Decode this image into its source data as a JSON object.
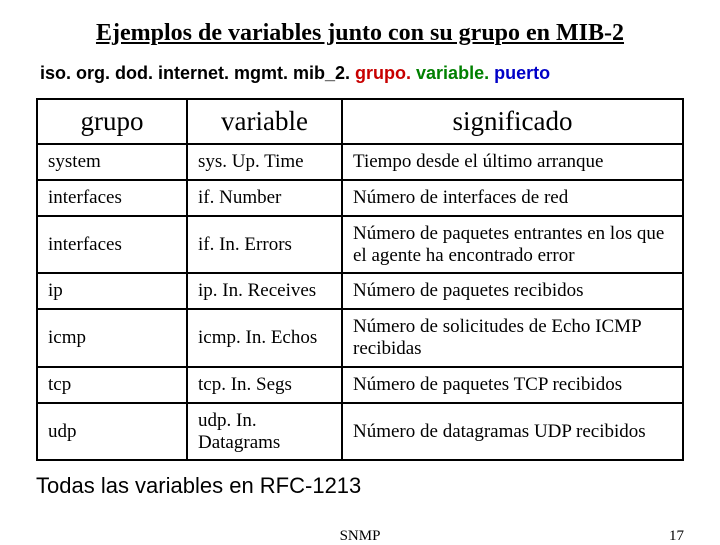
{
  "title": "Ejemplos de variables junto con su grupo en MIB-2",
  "oid": {
    "prefix": "iso. org. dod. internet. mgmt. mib_2.",
    "grupo": " grupo.",
    "variable": " variable.",
    "puerto": " puerto"
  },
  "headers": {
    "grupo": "grupo",
    "variable": "variable",
    "significado": "significado"
  },
  "rows": [
    {
      "grupo": "system",
      "variable": "sys. Up. Time",
      "significado": "Tiempo desde el último arranque"
    },
    {
      "grupo": "interfaces",
      "variable": "if. Number",
      "significado": "Número de interfaces de red"
    },
    {
      "grupo": "interfaces",
      "variable": "if. In. Errors",
      "significado": "Número de paquetes entrantes en los que el agente ha encontrado error"
    },
    {
      "grupo": "ip",
      "variable": "ip. In. Receives",
      "significado": "Número de paquetes recibidos"
    },
    {
      "grupo": "icmp",
      "variable": "icmp. In. Echos",
      "significado": "Número de solicitudes de Echo ICMP recibidas"
    },
    {
      "grupo": "tcp",
      "variable": "tcp. In. Segs",
      "significado": "Número de paquetes TCP recibidos"
    },
    {
      "grupo": "udp",
      "variable": "udp. In. Datagrams",
      "significado": "Número de datagramas UDP recibidos"
    }
  ],
  "footer_note": "Todas las variables en RFC-1213",
  "footer": {
    "label": "SNMP",
    "page": "17"
  }
}
